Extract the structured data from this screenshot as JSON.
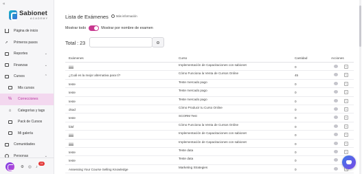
{
  "sidebar": {
    "brand": {
      "name": "Sabionet",
      "sub": "ACADEMY"
    },
    "items": [
      {
        "label": "Página de inicio",
        "icon": "home-icon",
        "chevron": false
      },
      {
        "label": "Primeros pasos",
        "icon": "rocket-icon",
        "chevron": false
      },
      {
        "label": "Reportes",
        "icon": "reports-icon",
        "chevron": true
      },
      {
        "label": "Finanzas",
        "icon": "finance-icon",
        "chevron": true
      },
      {
        "label": "Cursos",
        "icon": "courses-icon",
        "chevron": true
      }
    ],
    "subitems": [
      {
        "label": "Mis cursos",
        "icon": "my-courses-icon",
        "active": false
      },
      {
        "label": "Correcciones",
        "icon": "corrections-icon",
        "active": true
      },
      {
        "label": "Categorías y tags",
        "icon": "tag-icon",
        "active": false
      },
      {
        "label": "Pack de Cursos",
        "icon": "pack-icon",
        "active": false
      },
      {
        "label": "Mi galería",
        "icon": "gallery-icon",
        "active": false
      }
    ],
    "lower_items": [
      {
        "label": "Comunidades",
        "icon": "community-icon",
        "chevron": false
      },
      {
        "label": "Personas",
        "icon": "people-icon",
        "chevron": true
      }
    ],
    "notification_count": "15"
  },
  "main": {
    "title": "Lista de Exámenes",
    "more_info": "Más información",
    "toggle_left": "Mostrar todo",
    "toggle_right": "Mostrar por nombre de examen",
    "total_label": "Total : 23",
    "search": {
      "placeholder": "",
      "value": ""
    }
  },
  "table": {
    "headers": [
      "Exámenes",
      "Curso",
      "Cantidad",
      "Acciones"
    ],
    "rows": [
      {
        "exam": "jjjjjjj",
        "course": "Implementación de Capacitaciones con sabionet",
        "qty": "0"
      },
      {
        "exam": "¿Cuál es la mejor alternativa para tí?",
        "course": "Cómo Funciona la Venta de Cursos Online",
        "qty": "45"
      },
      {
        "exam": "teste",
        "course": "Teste mercado pago",
        "qty": "0"
      },
      {
        "exam": "teste",
        "course": "Teste mercado pago",
        "qty": "0"
      },
      {
        "exam": "teste",
        "course": "Teste mercado pago",
        "qty": "0"
      },
      {
        "exam": "dsad",
        "course": "Cómo Producir tu Curso Online",
        "qty": "0"
      },
      {
        "exam": "teste",
        "course": "SCORM Test",
        "qty": "0"
      },
      {
        "exam": "fdsf",
        "course": "Cómo Funciona la Venta de Cursos Online",
        "qty": "0"
      },
      {
        "exam": "jjjjjjj",
        "course": "Implementación de Capacitaciones con sabionet",
        "qty": "0"
      },
      {
        "exam": "jjjjjjj",
        "course": "Implementación de Capacitaciones con sabionet",
        "qty": "0"
      },
      {
        "exam": "teste",
        "course": "Teste data",
        "qty": "0"
      },
      {
        "exam": "teste",
        "course": "Teste data",
        "qty": "0"
      },
      {
        "exam": "Assessing Your Course Selling Knowledge",
        "course": "Marketing Strategies",
        "qty": "0"
      }
    ]
  },
  "colors": {
    "accent": "#c8388f",
    "active_bg": "#f3d8ef",
    "fab": "#5a5fe6",
    "badge": "#e33434"
  }
}
